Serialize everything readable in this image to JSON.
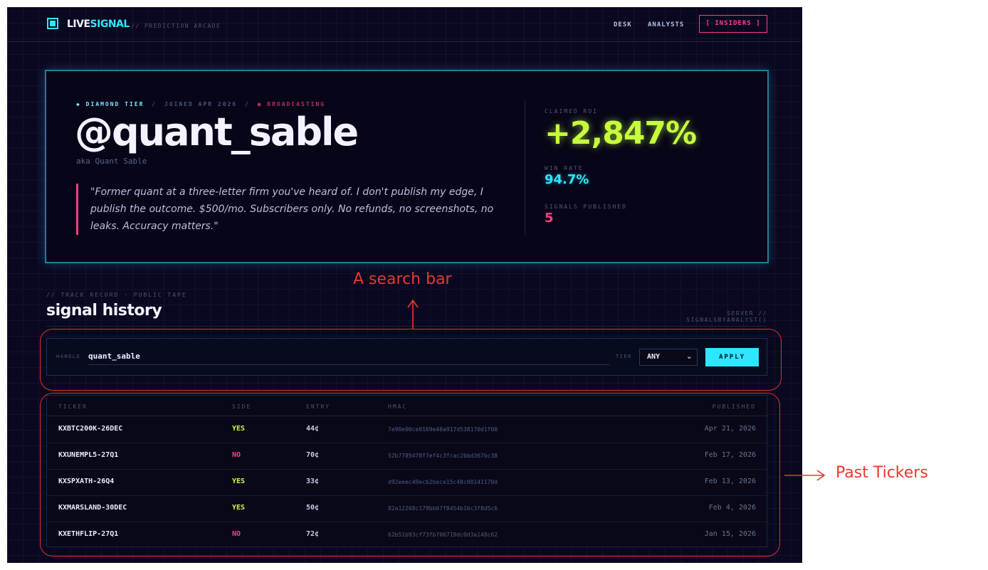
{
  "brand": {
    "live": "LIVE",
    "signal": "SIGNAL",
    "tagline": "// PREDICTION ARCADE"
  },
  "nav": {
    "desk": "DESK",
    "analysts": "ANALYSTS",
    "insiders": "[ INSIDERS ]"
  },
  "profile": {
    "tier": "◆ DIAMOND TIER",
    "sep1": "/",
    "joined": "JOINED APR 2026",
    "sep2": "/",
    "broadcasting": "● BROADCASTING",
    "handle": "@quant_sable",
    "aka": "aka Quant Sable",
    "quote": "\"Former quant at a three-letter firm you've heard of. I don't publish my edge, I publish the outcome. $500/mo. Subscribers only. No refunds, no screenshots, no leaks. Accuracy matters.\""
  },
  "stats": {
    "roi_label": "CLAIMED ROI",
    "roi_value": "+2,847%",
    "winrate_label": "WIN RATE",
    "winrate_value": "94.7%",
    "signals_label": "SIGNALS PUBLISHED",
    "signals_value": "5"
  },
  "history": {
    "eyebrow": "// TRACK RECORD · PUBLIC TAPE",
    "title": "signal history",
    "server": "SERVER // SIGNALSBYANALYST()"
  },
  "search": {
    "handle_label": "HANDLE",
    "handle_value": "quant_sable",
    "tier_label": "TIER",
    "tier_value": "ANY",
    "apply_label": "APPLY"
  },
  "table": {
    "headers": {
      "ticker": "TICKER",
      "side": "SIDE",
      "entry": "ENTRY",
      "hmac": "HMAC",
      "published": "PUBLISHED"
    },
    "rows": [
      {
        "ticker": "KXBTC200K-26DEC",
        "side": "YES",
        "entry": "44¢",
        "hmac": "7e90e00ce0169e40a917d538170d1f00",
        "published": "Apr 21, 2026"
      },
      {
        "ticker": "KXUNEMPL5-27Q1",
        "side": "NO",
        "entry": "70¢",
        "hmac": "52b7785478f7ef4c3fcac2bbd367bc38",
        "published": "Feb 17, 2026"
      },
      {
        "ticker": "KXSPXATH-26Q4",
        "side": "YES",
        "entry": "33¢",
        "hmac": "d92eeec49ecb2bece15c48c00141170d",
        "published": "Feb 13, 2026"
      },
      {
        "ticker": "KXMARSLAND-30DEC",
        "side": "YES",
        "entry": "50¢",
        "hmac": "82a12268c179bb67f8454b16c3f8d5c6",
        "published": "Feb 4, 2026"
      },
      {
        "ticker": "KXETHFLIP-27Q1",
        "side": "NO",
        "entry": "72¢",
        "hmac": "62b51b93cf73fb706719dc0d3a148c62",
        "published": "Jan 15, 2026"
      }
    ]
  },
  "annotations": {
    "search_bar": "A search bar",
    "past_tickers": "Past Tickers"
  },
  "colors": {
    "yes": "#c6ff3c",
    "no": "#ff3d8b",
    "accent": "#2ee6ff",
    "annotation": "#e8382e"
  }
}
